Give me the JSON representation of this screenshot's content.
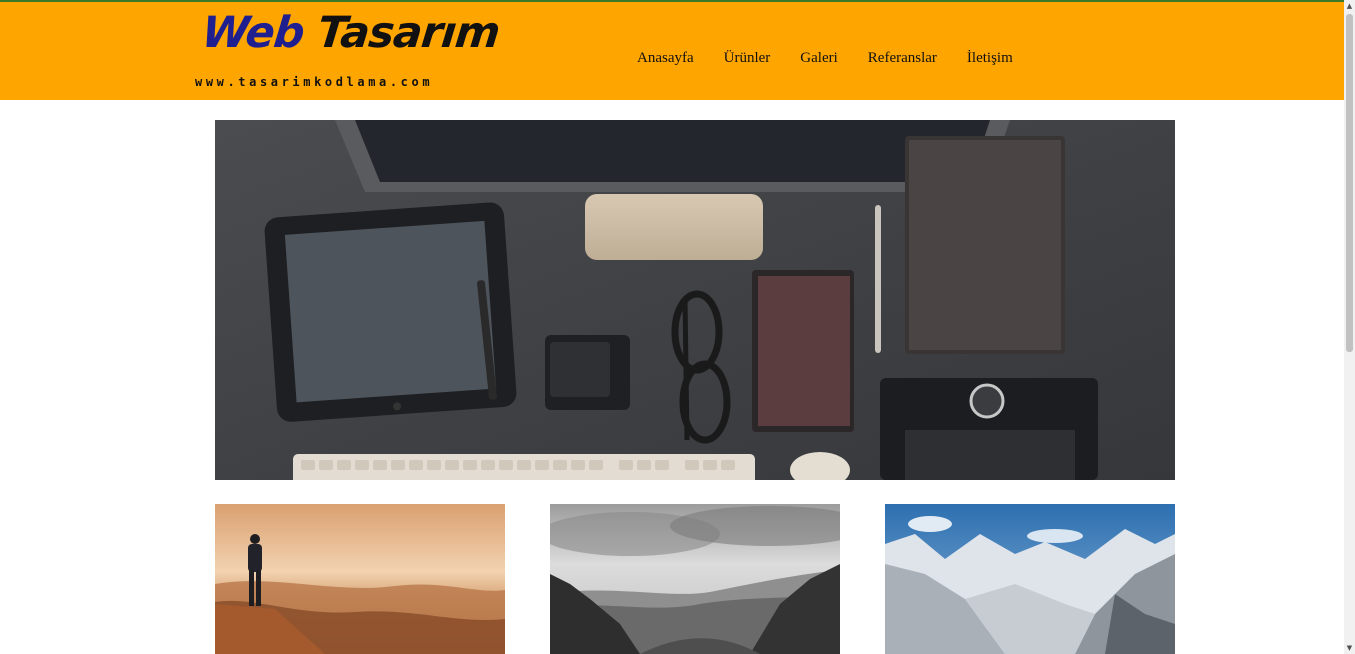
{
  "brand": {
    "title_part1": "Web",
    "title_part2": " Tasarım",
    "subtitle": "www.tasarimkodlama.com",
    "accent_color": "#ffa500",
    "logo_w_color": "#1f1f8f"
  },
  "nav": {
    "items": [
      {
        "label": "Anasayfa"
      },
      {
        "label": "Ürünler"
      },
      {
        "label": "Galeri"
      },
      {
        "label": "Referanslar"
      },
      {
        "label": "İletişim"
      }
    ]
  },
  "hero": {
    "icon": "desk-workspace-photo"
  },
  "gallery": {
    "items": [
      {
        "icon": "sunset-coast-photo"
      },
      {
        "icon": "bw-valley-photo"
      },
      {
        "icon": "snow-mountains-photo"
      }
    ]
  }
}
